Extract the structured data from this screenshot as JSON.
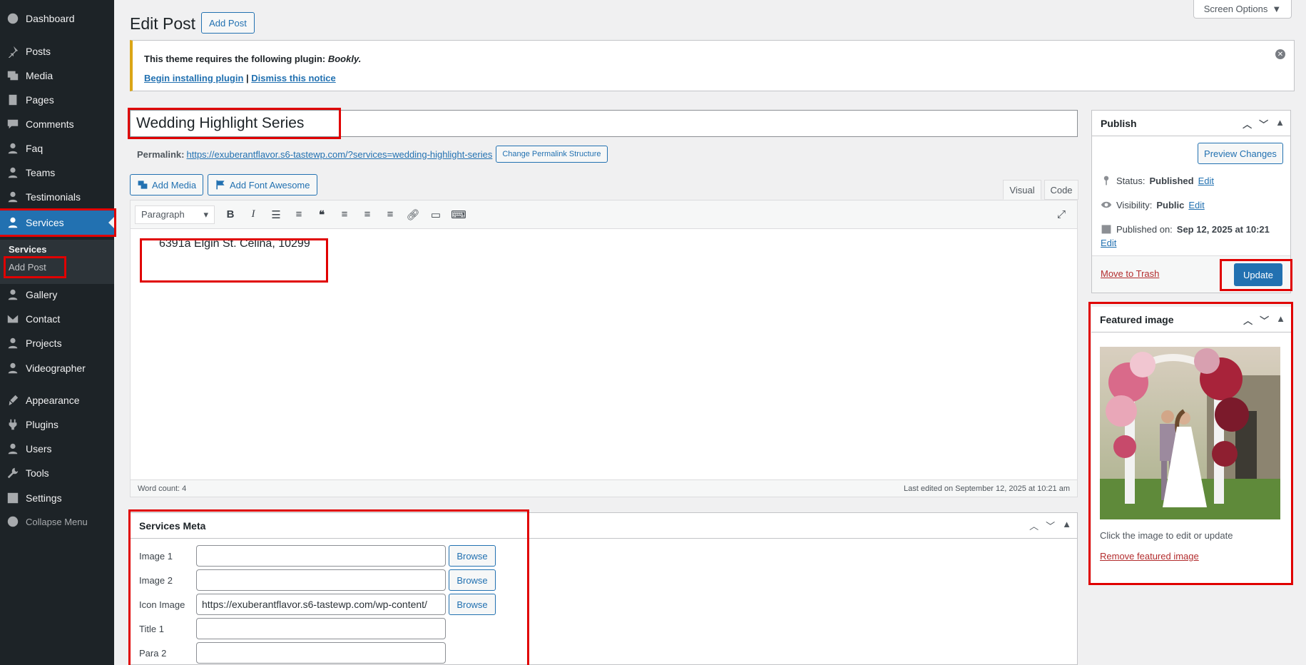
{
  "sidebar": {
    "items": [
      {
        "label": "Dashboard",
        "icon": "dashboard-icon"
      },
      {
        "label": "Posts",
        "icon": "pin-icon"
      },
      {
        "label": "Media",
        "icon": "media-icon"
      },
      {
        "label": "Pages",
        "icon": "pages-icon"
      },
      {
        "label": "Comments",
        "icon": "comment-icon"
      },
      {
        "label": "Faq",
        "icon": "user-icon"
      },
      {
        "label": "Teams",
        "icon": "user-icon"
      },
      {
        "label": "Testimonials",
        "icon": "user-icon"
      },
      {
        "label": "Services",
        "icon": "user-icon"
      },
      {
        "label": "Gallery",
        "icon": "user-icon"
      },
      {
        "label": "Contact",
        "icon": "mail-icon"
      },
      {
        "label": "Projects",
        "icon": "user-icon"
      },
      {
        "label": "Videographer",
        "icon": "user-icon"
      },
      {
        "label": "Appearance",
        "icon": "brush-icon"
      },
      {
        "label": "Plugins",
        "icon": "plugin-icon"
      },
      {
        "label": "Users",
        "icon": "user-icon"
      },
      {
        "label": "Tools",
        "icon": "wrench-icon"
      },
      {
        "label": "Settings",
        "icon": "settings-icon"
      }
    ],
    "submenu": {
      "title": "Services",
      "add": "Add Post"
    },
    "collapse": "Collapse Menu"
  },
  "header": {
    "title": "Edit Post",
    "add_post": "Add Post",
    "screen_options": "Screen Options"
  },
  "notice": {
    "text": "This theme requires the following plugin: ",
    "plugin": "Bookly.",
    "begin": "Begin installing plugin",
    "sep": "|",
    "dismiss": "Dismiss this notice"
  },
  "post": {
    "title": "Wedding Highlight Series",
    "permalink_label": "Permalink:",
    "permalink": "https://exuberantflavor.s6-tastewp.com/?services=wedding-highlight-series",
    "change_permalink": "Change Permalink Structure"
  },
  "editor": {
    "add_media": "Add Media",
    "add_font_awesome": "Add Font Awesome",
    "tab_visual": "Visual",
    "tab_code": "Code",
    "format": "Paragraph",
    "content": "6391a Elgin St. Celina, 10299",
    "word_count": "Word count: 4",
    "last_edited": "Last edited on September 12, 2025 at 10:21 am"
  },
  "services_meta": {
    "title": "Services Meta",
    "browse": "Browse",
    "fields": [
      {
        "label": "Image 1",
        "value": ""
      },
      {
        "label": "Image 2",
        "value": ""
      },
      {
        "label": "Icon Image",
        "value": "https://exuberantflavor.s6-tastewp.com/wp-content/"
      },
      {
        "label": "Title 1",
        "value": ""
      },
      {
        "label": "Para 2",
        "value": ""
      }
    ]
  },
  "publish": {
    "title": "Publish",
    "preview": "Preview Changes",
    "status_label": "Status:",
    "status": "Published",
    "visibility_label": "Visibility:",
    "visibility": "Public",
    "published_label": "Published on:",
    "published": "Sep 12, 2025 at 10:21",
    "edit": "Edit",
    "trash": "Move to Trash",
    "update": "Update"
  },
  "featured": {
    "title": "Featured image",
    "hint": "Click the image to edit or update",
    "remove": "Remove featured image"
  }
}
